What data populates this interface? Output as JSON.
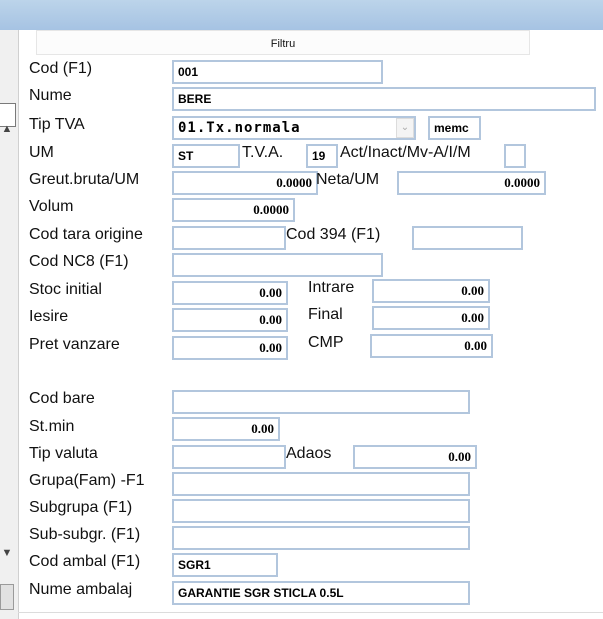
{
  "filter": {
    "label": "Filtru"
  },
  "icons": {
    "scroll_up": "▲",
    "scroll_down": "▼",
    "dropdown": "chevron-down-icon"
  },
  "labels": {
    "cod": "Cod (F1)",
    "nume": "Nume",
    "tip_tva": "Tip TVA",
    "um": "UM",
    "tva": "T.V.A.",
    "act_inact": "Act/Inact/Mv-A/I/M",
    "greut": "Greut.bruta/UM",
    "neta": "Neta/UM",
    "volum": "Volum",
    "cod_tara": "Cod tara origine",
    "cod394": "Cod 394 (F1)",
    "cod_nc8": "Cod NC8 (F1)",
    "stoc_initial": "Stoc initial",
    "intrare": "Intrare",
    "iesire": "Iesire",
    "final": "Final",
    "pret_vanzare": "Pret vanzare",
    "cmp": "CMP",
    "cod_bare": "Cod bare",
    "st_min": "St.min",
    "tip_valuta": "Tip valuta",
    "adaos": "Adaos",
    "grupa": "Grupa(Fam) -F1",
    "subgrupa": "Subgrupa  (F1)",
    "sub_subgr": "Sub-subgr. (F1)",
    "cod_ambal": "Cod ambal (F1)",
    "nume_ambalaj": "Nume ambalaj"
  },
  "values": {
    "cod": "001",
    "nume": "BERE",
    "tip_tva": "01.Tx.normala",
    "memo": "memc",
    "um": "ST",
    "tva": "19",
    "act_inact": "",
    "greut": "0.0000",
    "neta": "0.0000",
    "volum": "0.0000",
    "cod_tara": "",
    "cod394": "",
    "cod_nc8": "",
    "stoc_initial": "0.00",
    "intrare": "0.00",
    "iesire": "0.00",
    "final": "0.00",
    "pret_vanzare": "0.00",
    "cmp": "0.00",
    "cod_bare": "",
    "st_min": "0.00",
    "tip_valuta": "",
    "adaos": "0.00",
    "grupa": "",
    "subgrupa": "",
    "sub_subgr": "",
    "cod_ambal": "SGR1",
    "nume_ambalaj": "GARANTIE SGR STICLA 0.5L"
  }
}
